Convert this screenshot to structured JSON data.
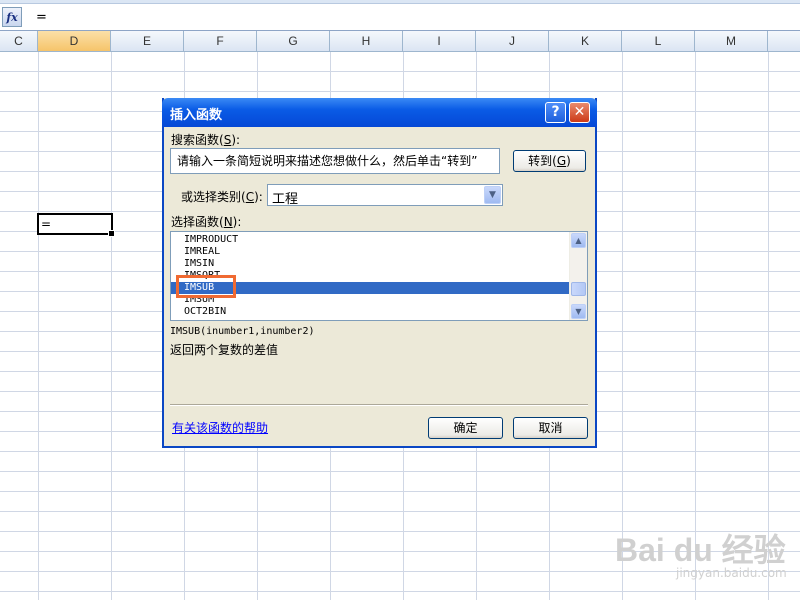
{
  "formula_bar": {
    "fx_label": "fx",
    "content": "="
  },
  "columns": [
    "C",
    "D",
    "E",
    "F",
    "G",
    "H",
    "I",
    "J",
    "K",
    "L",
    "M"
  ],
  "active_cell": {
    "column": "D",
    "value": "="
  },
  "dialog": {
    "title": "插入函数",
    "help_btn": "?",
    "close_btn": "✕",
    "search_label": "搜索函数(",
    "search_key": "S",
    "search_label_end": "):",
    "search_text": "请输入一条简短说明来描述您想做什么，然后单击“转到”",
    "goto_label": "转到(",
    "goto_key": "G",
    "goto_label_end": ")",
    "category_label": "或选择类别(",
    "category_key": "C",
    "category_label_end": "):",
    "category_value": "工程",
    "select_label": "选择函数(",
    "select_key": "N",
    "select_label_end": "):",
    "functions": [
      "IMPRODUCT",
      "IMREAL",
      "IMSIN",
      "IMSQRT",
      "IMSUB",
      "IMSUM",
      "OCT2BIN"
    ],
    "selected_function": "IMSUB",
    "signature": "IMSUB(inumber1,inumber2)",
    "description": "返回两个复数的差值",
    "help_link": "有关该函数的帮助",
    "ok_label": "确定",
    "cancel_label": "取消"
  },
  "watermark": {
    "text": "Bai du 经验",
    "sub": "jingyan.baidu.com"
  }
}
